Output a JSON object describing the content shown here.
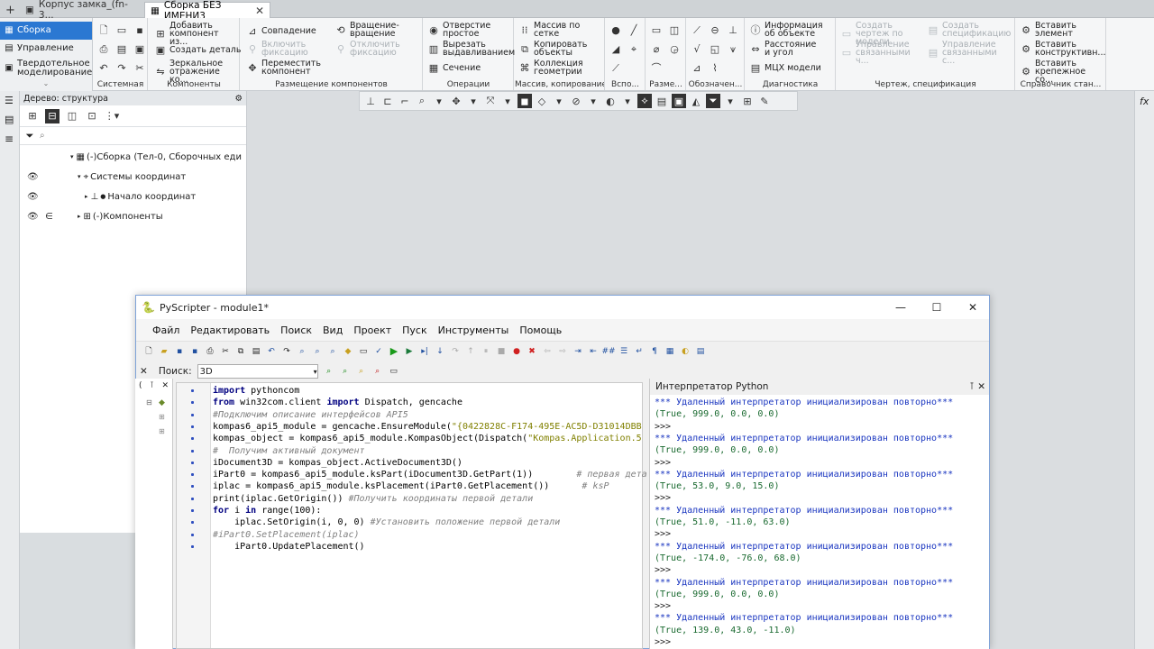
{
  "tabs": [
    {
      "label": "Корпус замка_(fn-3..."
    },
    {
      "label": "Сборка БЕЗ ИМЕНИ3"
    }
  ],
  "left_panel": [
    {
      "label": "Сборка"
    },
    {
      "label": "Управление"
    },
    {
      "label": "Твердотельное моделирование"
    }
  ],
  "ribbon": {
    "groups": [
      "Системная",
      "Компоненты",
      "Размещение компонентов",
      "Операции",
      "Массив, копирование",
      "Вспо...",
      "Разме...",
      "Обозначен...",
      "Диагностика",
      "Чертеж, спецификация",
      "Справочник стан..."
    ],
    "buttons": {
      "add_component": "Добавить компонент из...",
      "create_part": "Создать деталь",
      "mirror": "Зеркальное отражение ко...",
      "coincidence": "Совпадение",
      "enable_fix": "Включить фиксацию",
      "move_component": "Переместить компонент",
      "rotate": "Вращение-вращение",
      "disable_fix": "Отключить фиксацию",
      "hole": "Отверстие простое",
      "cut_extrude": "Вырезать выдавливанием",
      "section": "Сечение",
      "grid_array": "Массив по сетке",
      "copy_objects": "Копировать объекты",
      "geom_collection": "Коллекция геометрии",
      "obj_info": "Информация об объекте",
      "distance_angle": "Расстояние и угол",
      "mass_props": "МЦХ модели",
      "create_drawing": "Создать чертеж по модели",
      "create_spec": "Создать спецификацию",
      "manage_linked_1": "Управление связанными ч...",
      "manage_linked_2": "Управление связанными с...",
      "insert_element": "Вставить элемент",
      "insert_design": "Вставить конструктивн...",
      "insert_fastener": "Вставить крепежное со..."
    }
  },
  "tree": {
    "title": "Дерево: структура",
    "rows": [
      {
        "label": "(-)Сборка (Тел-0, Сборочных еди"
      },
      {
        "label": "Системы координат"
      },
      {
        "label": "Начало координат"
      },
      {
        "label": "(-)Компоненты"
      }
    ]
  },
  "fx": "fx",
  "pyscripter": {
    "title": "PyScripter - module1*",
    "menu": [
      "Файл",
      "Редактировать",
      "Поиск",
      "Вид",
      "Проект",
      "Пуск",
      "Инструменты",
      "Помощь"
    ],
    "search_label": "Поиск:",
    "search_value": "3D",
    "interp_title": "Интерпретатор Python",
    "code": [
      "import pythoncom",
      "from win32com.client import Dispatch, gencache",
      "#Подключим описание интерфейсов API5",
      "kompas6_api5_module = gencache.EnsureModule(\"{0422828C-F174-495E-AC5D-D31014DBB",
      "kompas_object = kompas6_api5_module.KompasObject(Dispatch(\"Kompas.Application.5",
      "#  Получим активный документ",
      "iDocument3D = kompas_object.ActiveDocument3D()",
      "iPart0 = kompas6_api5_module.ksPart(iDocument3D.GetPart(1))        # первая дета",
      "iplac = kompas6_api5_module.ksPlacement(iPart0.GetPlacement())      # ksP",
      "print(iplac.GetOrigin()) #Получить координаты первой детали",
      "for i in range(100):",
      "    iplac.SetOrigin(i, 0, 0) #Установить положение первой детали",
      "#iPart0.SetPlacement(iplac)",
      "    iPart0.UpdatePlacement()"
    ],
    "interp": [
      "*** Удаленный интерпретатор инициализирован повторно***",
      "(True, 999.0, 0.0, 0.0)",
      ">>>",
      "*** Удаленный интерпретатор инициализирован повторно***",
      "(True, 999.0, 0.0, 0.0)",
      ">>>",
      "*** Удаленный интерпретатор инициализирован повторно***",
      "(True, 53.0, 9.0, 15.0)",
      ">>>",
      "*** Удаленный интерпретатор инициализирован повторно***",
      "(True, 51.0, -11.0, 63.0)",
      ">>>",
      "*** Удаленный интерпретатор инициализирован повторно***",
      "(True, -174.0, -76.0, 68.0)",
      ">>>",
      "*** Удаленный интерпретатор инициализирован повторно***",
      "(True, 999.0, 0.0, 0.0)",
      ">>>",
      "*** Удаленный интерпретатор инициализирован повторно***",
      "(True, 139.0, 43.0, -11.0)",
      ">>>"
    ]
  }
}
